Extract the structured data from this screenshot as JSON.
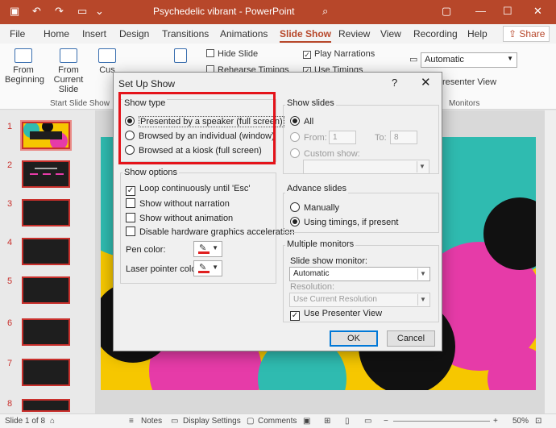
{
  "window": {
    "doc_title": "Psychedelic vibrant - PowerPoint",
    "quick_access": [
      "save-icon",
      "undo-icon",
      "redo-icon",
      "present-icon"
    ]
  },
  "tabs": [
    "File",
    "Home",
    "Insert",
    "Design",
    "Transitions",
    "Animations",
    "Slide Show",
    "Review",
    "View",
    "Recording",
    "Help"
  ],
  "active_tab": "Slide Show",
  "share_label": "Share",
  "ribbon": {
    "from_beginning": "From Beginning",
    "from_current": "From Current Slide",
    "custom_partial": "Cus",
    "hide_slide": "Hide Slide",
    "rehearse_partial": "Rehearse Timings",
    "play_narrations": "Play Narrations",
    "use_timings_partial": "Use Timings",
    "monitor_value": "Automatic",
    "presenter_view_partial": "resenter View",
    "group_start": "Start Slide Show",
    "group_monitors": "Monitors"
  },
  "slides_panel": {
    "numbers": [
      "1",
      "2",
      "3",
      "4",
      "5",
      "6",
      "7",
      "8"
    ]
  },
  "status": {
    "slide_counter": "Slide 1 of 8",
    "notes": "Notes",
    "display_settings": "Display Settings",
    "comments": "Comments",
    "zoom": "50%"
  },
  "dialog": {
    "title": "Set Up Show",
    "help": "?",
    "show_type": {
      "legend": "Show type",
      "options": [
        "Presented by a speaker (full screen)",
        "Browsed by an individual (window)",
        "Browsed at a kiosk (full screen)"
      ],
      "selected": 0
    },
    "show_options": {
      "legend": "Show options",
      "loop": "Loop continuously until 'Esc'",
      "no_narration": "Show without narration",
      "no_animation": "Show without animation",
      "disable_hw": "Disable hardware graphics acceleration",
      "loop_checked": true,
      "pen_color_label": "Pen color:",
      "laser_color_label": "Laser pointer color:",
      "pen_color": "#e02020",
      "laser_color": "#e02020"
    },
    "show_slides": {
      "legend": "Show slides",
      "all": "All",
      "from": "From:",
      "from_value": "1",
      "to": "To:",
      "to_value": "8",
      "custom_show": "Custom show:"
    },
    "advance_slides": {
      "legend": "Advance slides",
      "manually": "Manually",
      "using_timings": "Using timings, if present"
    },
    "multiple_monitors": {
      "legend": "Multiple monitors",
      "monitor_label": "Slide show monitor:",
      "monitor_value": "Automatic",
      "resolution_label": "Resolution:",
      "resolution_value": "Use Current Resolution",
      "presenter_view": "Use Presenter View"
    },
    "ok": "OK",
    "cancel": "Cancel"
  },
  "colors": {
    "accent": "#b7472a",
    "highlight": "#e4131a"
  }
}
